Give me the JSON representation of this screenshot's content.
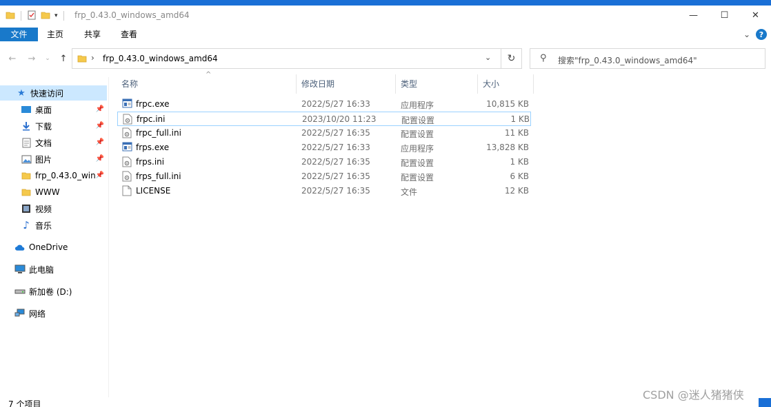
{
  "window": {
    "title": "frp_0.43.0_windows_amd64"
  },
  "ribbon": {
    "tabs": [
      "文件",
      "主页",
      "共享",
      "查看"
    ],
    "help": "?"
  },
  "address": {
    "path": "frp_0.43.0_windows_amd64"
  },
  "search": {
    "placeholder": "搜索\"frp_0.43.0_windows_amd64\""
  },
  "sidebar": {
    "quick_access": "快速访问",
    "items": [
      {
        "label": "桌面"
      },
      {
        "label": "下载"
      },
      {
        "label": "文档"
      },
      {
        "label": "图片"
      },
      {
        "label": "frp_0.43.0_wind"
      },
      {
        "label": "WWW"
      },
      {
        "label": "视频"
      },
      {
        "label": "音乐"
      }
    ],
    "onedrive": "OneDrive",
    "thispc": "此电脑",
    "drive": "新加卷 (D:)",
    "network": "网络"
  },
  "columns": {
    "name": "名称",
    "date": "修改日期",
    "type": "类型",
    "size": "大小"
  },
  "files": [
    {
      "name": "frpc.exe",
      "date": "2022/5/27 16:33",
      "type": "应用程序",
      "size": "10,815 KB",
      "icon": "exe"
    },
    {
      "name": "frpc.ini",
      "date": "2023/10/20 11:23",
      "type": "配置设置",
      "size": "1 KB",
      "icon": "ini"
    },
    {
      "name": "frpc_full.ini",
      "date": "2022/5/27 16:35",
      "type": "配置设置",
      "size": "11 KB",
      "icon": "ini"
    },
    {
      "name": "frps.exe",
      "date": "2022/5/27 16:33",
      "type": "应用程序",
      "size": "13,828 KB",
      "icon": "exe"
    },
    {
      "name": "frps.ini",
      "date": "2022/5/27 16:35",
      "type": "配置设置",
      "size": "1 KB",
      "icon": "ini"
    },
    {
      "name": "frps_full.ini",
      "date": "2022/5/27 16:35",
      "type": "配置设置",
      "size": "6 KB",
      "icon": "ini"
    },
    {
      "name": "LICENSE",
      "date": "2022/5/27 16:35",
      "type": "文件",
      "size": "12 KB",
      "icon": "file"
    }
  ],
  "status": {
    "count": "7 个项目"
  },
  "watermark": "CSDN @迷人猪猪侠"
}
